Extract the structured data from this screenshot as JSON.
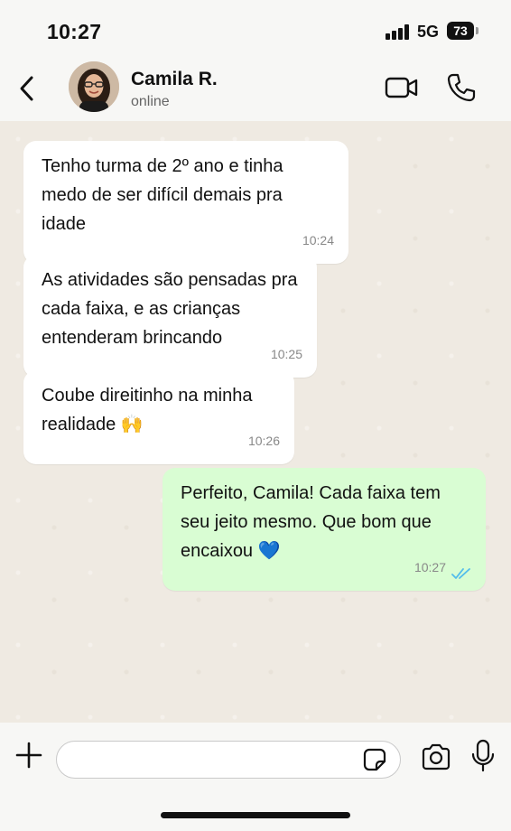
{
  "status_bar": {
    "time": "10:27",
    "network": "5G",
    "battery": "73"
  },
  "header": {
    "contact_name": "Camila R.",
    "contact_status": "online"
  },
  "messages": [
    {
      "direction": "incoming",
      "text": "Tenho turma de 2º ano e tinha medo de ser difícil demais pra idade",
      "time": "10:24"
    },
    {
      "direction": "incoming",
      "text": "As atividades são pensadas pra cada faixa, e as crianças entenderam brincando",
      "time": "10:25"
    },
    {
      "direction": "incoming",
      "text": "Coube direitinho na minha realidade 🙌",
      "time": "10:26"
    },
    {
      "direction": "outgoing",
      "text": "Perfeito, Camila! Cada faixa tem seu jeito mesmo. Que bom que encaixou 💙",
      "time": "10:27",
      "status": "read"
    }
  ],
  "composer": {
    "placeholder": ""
  },
  "icons": {
    "back": "chevron-left-icon",
    "video": "video-camera-icon",
    "call": "phone-icon",
    "attach": "plus-icon",
    "sticker": "sticker-icon",
    "camera": "camera-icon",
    "mic": "microphone-icon",
    "read_receipt": "double-check-icon"
  },
  "colors": {
    "incoming_bubble": "#ffffff",
    "outgoing_bubble": "#d9fdd3",
    "read_ticks": "#53bdeb",
    "chat_background": "#efeae2"
  }
}
